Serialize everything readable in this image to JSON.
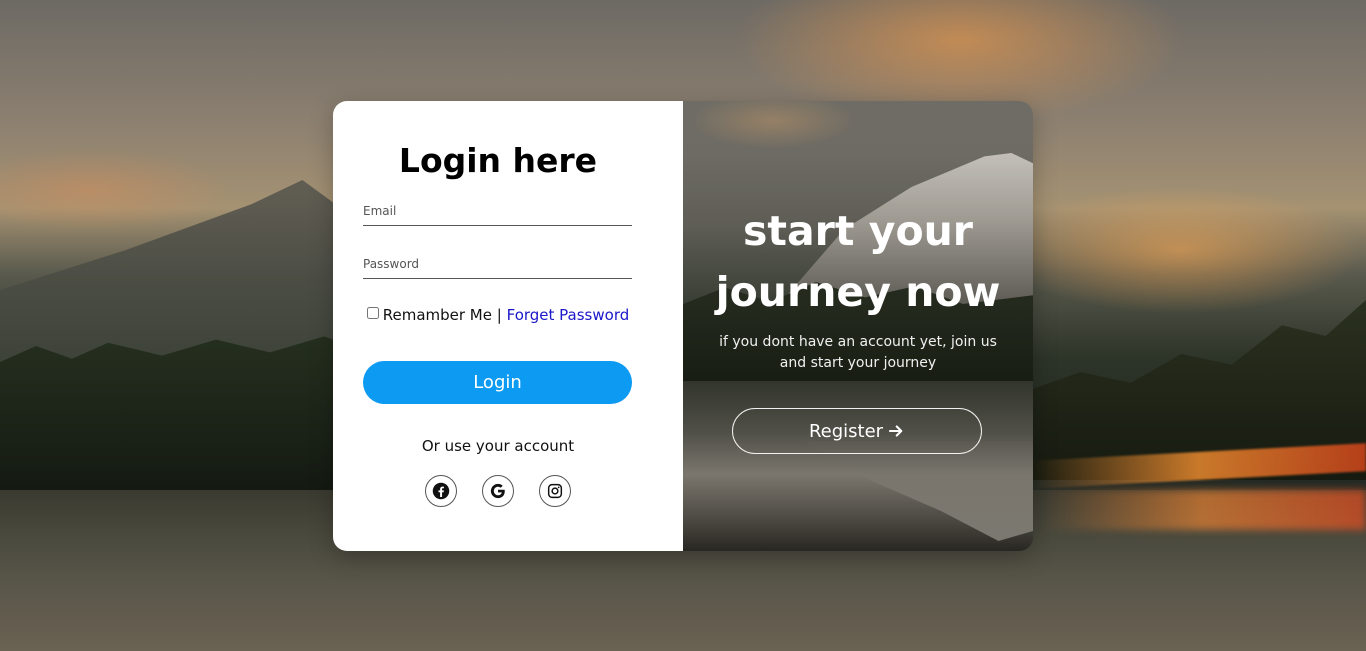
{
  "login": {
    "title": "Login here",
    "email_placeholder": "Email",
    "password_placeholder": "Password",
    "remember_label": "Remamber Me",
    "separator": "|",
    "forget_link": "Forget Password",
    "login_button": "Login",
    "alt_text": "Or use your account",
    "socials": [
      {
        "name": "facebook",
        "icon": "facebook-icon"
      },
      {
        "name": "google",
        "icon": "google-icon"
      },
      {
        "name": "instagram",
        "icon": "instagram-icon"
      }
    ]
  },
  "promo": {
    "title_line1": "start your",
    "title_line2": "journey now",
    "subtitle": "if you dont have an account yet, join us and start your journey",
    "register_button": "Register",
    "register_icon": "arrow-right-icon"
  },
  "colors": {
    "login_button": "#0d9af2",
    "link": "#1a17c9",
    "panel": "#ffffff"
  }
}
